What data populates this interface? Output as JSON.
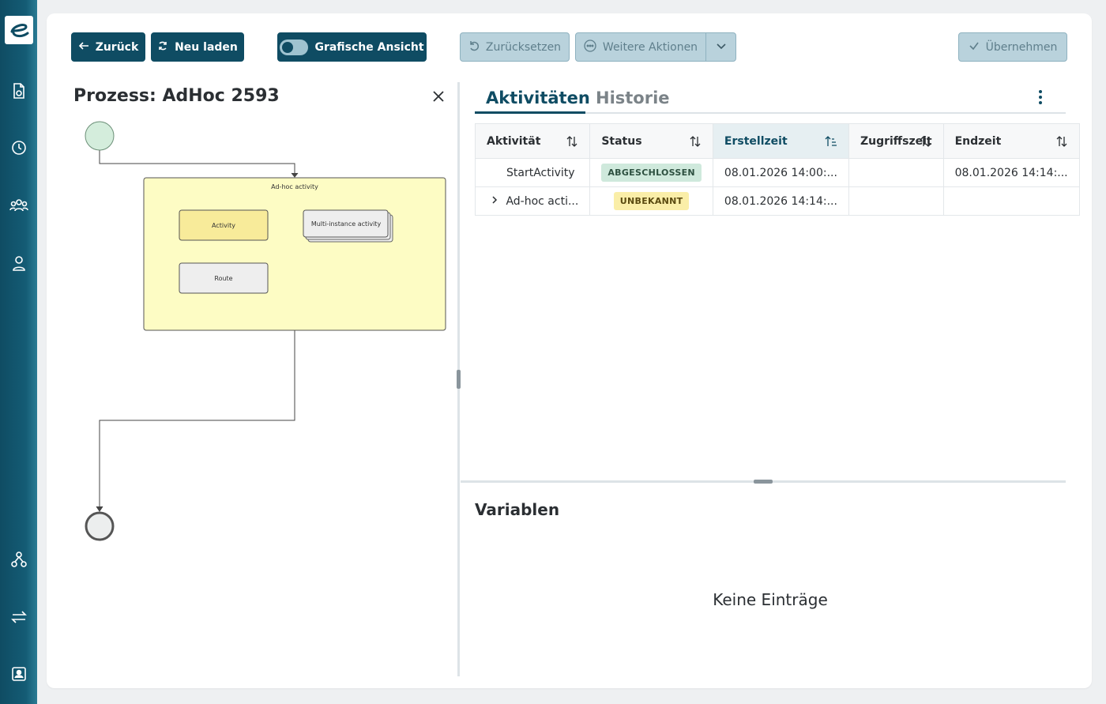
{
  "sidebar": {
    "logo_letter": "e",
    "icons": [
      "document-sync-icon",
      "clock-icon",
      "group-icon",
      "user-icon",
      "workflow-icon",
      "transfer-icon",
      "contact-card-icon"
    ]
  },
  "toolbar": {
    "back_label": "Zurück",
    "reload_label": "Neu laden",
    "graphic_view_label": "Grafische Ansicht",
    "reset_label": "Zurücksetzen",
    "more_actions_label": "Weitere Aktionen",
    "apply_label": "Übernehmen"
  },
  "process": {
    "title": "Prozess: AdHoc 2593",
    "diagram": {
      "subprocess_label": "Ad-hoc activity",
      "activity_label": "Activity",
      "multi_instance_label": "Multi-instance activity",
      "route_label": "Route"
    }
  },
  "tabs": [
    {
      "label": "Aktivitäten"
    },
    {
      "label": "Historie"
    }
  ],
  "table": {
    "columns": [
      "Aktivität",
      "Status",
      "Erstellzeit",
      "Zugriffszeit",
      "Endzeit"
    ],
    "rows": [
      {
        "activity": "StartActivity",
        "status": "ABGESCHLOSSEN",
        "created": "08.01.2026 14:00:...",
        "accessed": "",
        "ended": "08.01.2026 14:14:..."
      },
      {
        "activity": "Ad-hoc acti...",
        "status": "UNBEKANNT",
        "created": "08.01.2026 14:14:...",
        "accessed": "",
        "ended": ""
      }
    ]
  },
  "variables": {
    "title": "Variablen",
    "empty_text": "Keine Einträge"
  },
  "colors": {
    "brand": "#0f4c63",
    "status_done": "#cfe9dc",
    "status_unknown": "#faeea8"
  }
}
